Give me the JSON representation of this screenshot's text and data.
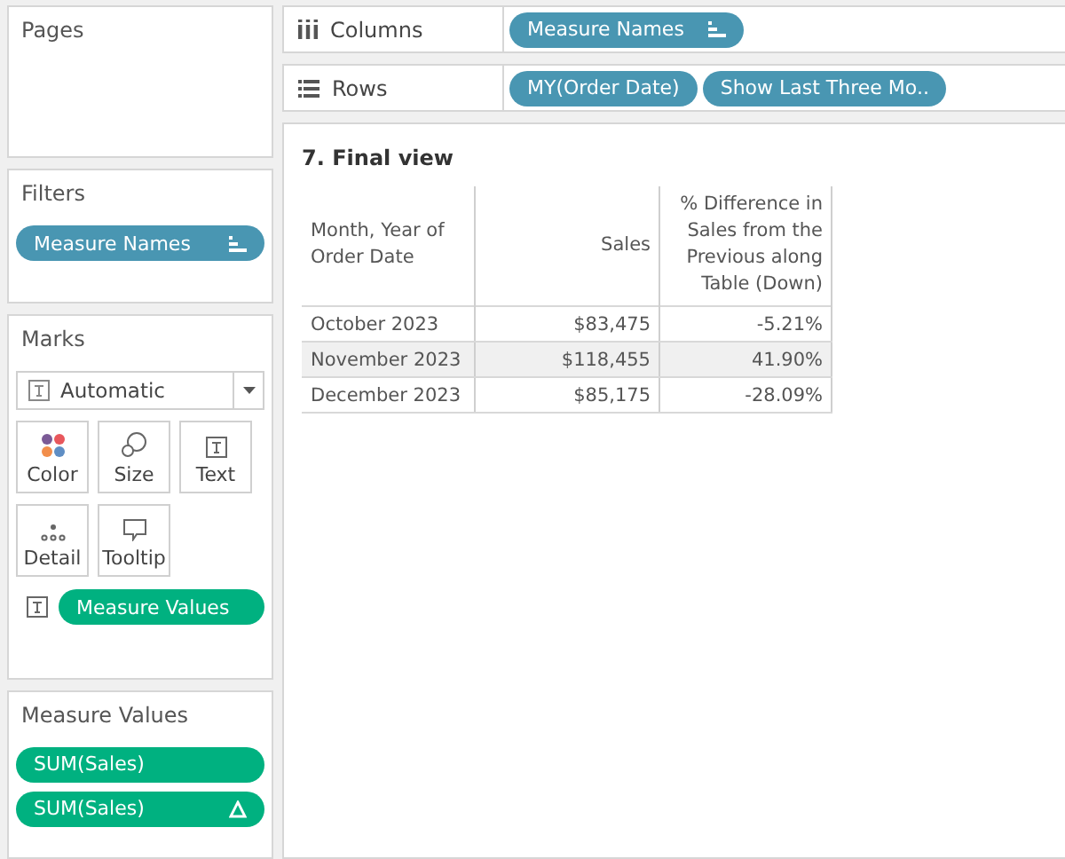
{
  "pages": {
    "title": "Pages"
  },
  "filters": {
    "title": "Filters",
    "pills": [
      {
        "label": "Measure Names",
        "kind": "sorted-dimension"
      }
    ]
  },
  "marks": {
    "title": "Marks",
    "mark_type": "Automatic",
    "cards": [
      {
        "label": "Color"
      },
      {
        "label": "Size"
      },
      {
        "label": "Text"
      },
      {
        "label": "Detail"
      },
      {
        "label": "Tooltip"
      }
    ],
    "pills": [
      {
        "label": "Measure Values",
        "kind": "measure"
      }
    ]
  },
  "measure_values": {
    "title": "Measure Values",
    "pills": [
      {
        "label": "SUM(Sales)",
        "kind": "measure"
      },
      {
        "label": "SUM(Sales)",
        "kind": "calculated-measure"
      }
    ]
  },
  "columns_shelf": {
    "label": "Columns",
    "pills": [
      {
        "label": "Measure Names",
        "kind": "sorted-dimension"
      }
    ]
  },
  "rows_shelf": {
    "label": "Rows",
    "pills": [
      {
        "label": "MY(Order Date)",
        "kind": "dimension"
      },
      {
        "label": "Show Last Three Mo..",
        "kind": "dimension"
      }
    ]
  },
  "view": {
    "title": "7. Final view",
    "table": {
      "columns": [
        "Month, Year of Order Date",
        "Sales",
        "% Difference in Sales from the Previous along Table (Down)"
      ],
      "rows": [
        {
          "cells": [
            "October 2023",
            "$83,475",
            "-5.21%"
          ],
          "shaded": false
        },
        {
          "cells": [
            "November 2023",
            "$118,455",
            "41.90%"
          ],
          "shaded": true
        },
        {
          "cells": [
            "December 2023",
            "$85,175",
            "-28.09%"
          ],
          "shaded": false
        }
      ]
    }
  }
}
